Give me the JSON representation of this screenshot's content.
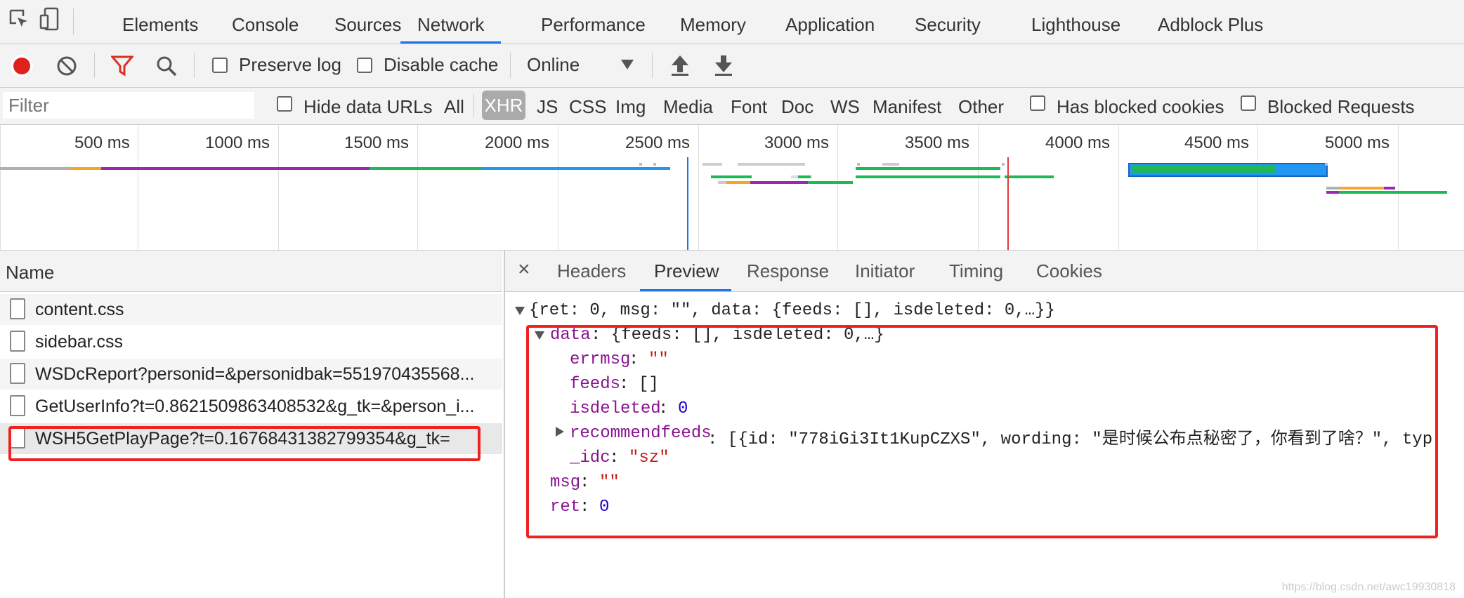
{
  "tabs": {
    "items": [
      "Elements",
      "Console",
      "Sources",
      "Network",
      "Performance",
      "Memory",
      "Application",
      "Security",
      "Lighthouse",
      "Adblock Plus"
    ],
    "active": "Network"
  },
  "toolbar": {
    "preserve_log": "Preserve log",
    "disable_cache": "Disable cache",
    "throttle": "Online"
  },
  "filter": {
    "placeholder": "Filter",
    "hide_data_urls": "Hide data URLs",
    "types": [
      "All",
      "XHR",
      "JS",
      "CSS",
      "Img",
      "Media",
      "Font",
      "Doc",
      "WS",
      "Manifest",
      "Other"
    ],
    "active_type": "XHR",
    "has_blocked_cookies": "Has blocked cookies",
    "blocked_requests": "Blocked Requests"
  },
  "overview": {
    "ticks": [
      "500 ms",
      "1000 ms",
      "1500 ms",
      "2000 ms",
      "2500 ms",
      "3000 ms",
      "3500 ms",
      "4000 ms",
      "4500 ms",
      "5000 ms"
    ]
  },
  "requests": {
    "header": "Name",
    "items": [
      "content.css",
      "sidebar.css",
      "WSDcReport?personid=&personidbak=551970435568...",
      "GetUserInfo?t=0.8621509863408532&g_tk=&person_i...",
      "WSH5GetPlayPage?t=0.16768431382799354&g_tk="
    ]
  },
  "detail": {
    "close": "×",
    "tabs": [
      "Headers",
      "Preview",
      "Response",
      "Initiator",
      "Timing",
      "Cookies"
    ],
    "active": "Preview",
    "preview": {
      "root": "{ret: 0, msg: \"\", data: {feeds: [], isdeleted: 0,…}}",
      "data_key": "data",
      "data_summary": ": {feeds: [], isdeleted: 0,…}",
      "errmsg_key": "errmsg",
      "errmsg_val": "\"\"",
      "feeds_key": "feeds",
      "feeds_val": "[]",
      "isdeleted_key": "isdeleted",
      "isdeleted_val": "0",
      "recommendfeeds_key": "recommendfeeds",
      "recommendfeeds_val": ": [{id: \"778iGi3It1KupCZXS\", wording: \"是时候公布点秘密了，你看到了啥？\", typ",
      "idc_key": "_idc",
      "idc_val": "\"sz\"",
      "msg_key": "msg",
      "msg_val": "\"\"",
      "ret_key": "ret",
      "ret_val": "0"
    }
  },
  "watermark": "https://blog.csdn.net/awc19930818",
  "colors": {
    "record": "#e0201a",
    "filter_active": "#d93025",
    "highlight": "#ee2222",
    "accent": "#1a73e8"
  }
}
